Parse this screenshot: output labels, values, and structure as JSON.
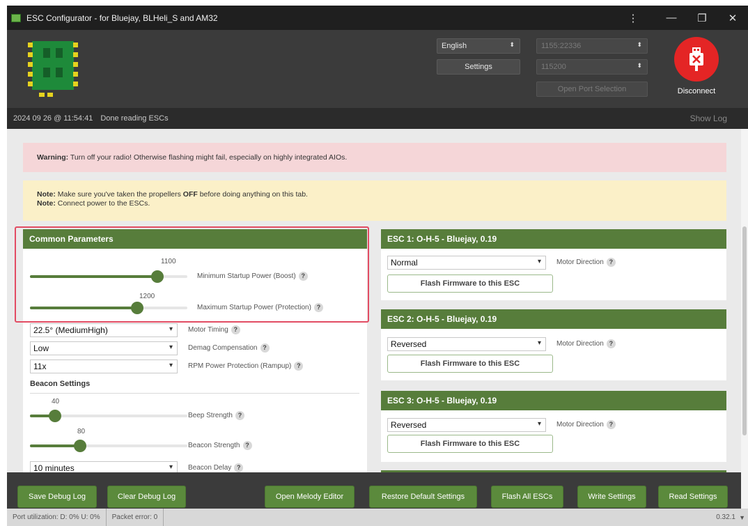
{
  "window": {
    "title": "ESC Configurator - for Bluejay, BLHeli_S and AM32",
    "controls": {
      "more": "⋮",
      "minimize": "—",
      "restore": "❐",
      "close": "✕"
    }
  },
  "header": {
    "language": "English",
    "settings_label": "Settings",
    "port": "1155:22336",
    "baud": "115200",
    "open_port_label": "Open Port Selection",
    "disconnect_label": "Disconnect"
  },
  "status": {
    "timestamp": "2024 09 26 @ 11:54:41",
    "message": "Done reading ESCs",
    "show_log": "Show Log"
  },
  "warning": {
    "prefix": "Warning:",
    "text": " Turn off your radio! Otherwise flashing might fail, especially on highly integrated AIOs."
  },
  "notes": {
    "line1_prefix": "Note:",
    "line1_text": " Make sure you've taken the propellers ",
    "line1_bold": "OFF",
    "line1_suffix": " before doing anything on this tab.",
    "line2_prefix": "Note:",
    "line2_text": " Connect power to the ESCs."
  },
  "common": {
    "title": "Common Parameters",
    "min_startup_value": "1100",
    "min_startup_fraction": 0.81,
    "min_startup_label": "Minimum Startup Power (Boost)",
    "max_startup_value": "1200",
    "max_startup_fraction": 0.68,
    "max_startup_label": "Maximum Startup Power (Protection)",
    "motor_timing_value": "22.5° (MediumHigh)",
    "motor_timing_label": "Motor Timing",
    "demag_value": "Low",
    "demag_label": "Demag Compensation",
    "rpm_value": "11x",
    "rpm_label": "RPM Power Protection (Rampup)",
    "beacon_title": "Beacon Settings",
    "beep_value": "40",
    "beep_fraction": 0.16,
    "beep_label": "Beep Strength",
    "beacon_value": "80",
    "beacon_fraction": 0.32,
    "beacon_label": "Beacon Strength",
    "beacon_delay_value": "10 minutes",
    "beacon_delay_label": "Beacon Delay"
  },
  "escs": [
    {
      "title": "ESC 1: O-H-5 - Bluejay, 0.19",
      "direction": "Normal",
      "direction_label": "Motor Direction",
      "flash_label": "Flash Firmware to this ESC"
    },
    {
      "title": "ESC 2: O-H-5 - Bluejay, 0.19",
      "direction": "Reversed",
      "direction_label": "Motor Direction",
      "flash_label": "Flash Firmware to this ESC"
    },
    {
      "title": "ESC 3: O-H-5 - Bluejay, 0.19",
      "direction": "Reversed",
      "direction_label": "Motor Direction",
      "flash_label": "Flash Firmware to this ESC"
    }
  ],
  "help_glyph": "?",
  "dropdown_glyph": "▾",
  "footer": {
    "save_debug": "Save Debug Log",
    "clear_debug": "Clear Debug Log",
    "melody": "Open Melody Editor",
    "restore": "Restore Default Settings",
    "flash_all": "Flash All ESCs",
    "write": "Write Settings",
    "read": "Read Settings"
  },
  "bottom": {
    "port_util": "Port utilization: D: 0% U: 0%",
    "packet_error": "Packet error: 0",
    "version": "0.32.1"
  },
  "colors": {
    "accent_green": "#577d3b",
    "button_green": "#5b8a3c",
    "disconnect_red": "#e42525",
    "warning_bg": "#f5d6d8",
    "note_bg": "#fbf0c8",
    "highlight_border": "#e24c63"
  }
}
